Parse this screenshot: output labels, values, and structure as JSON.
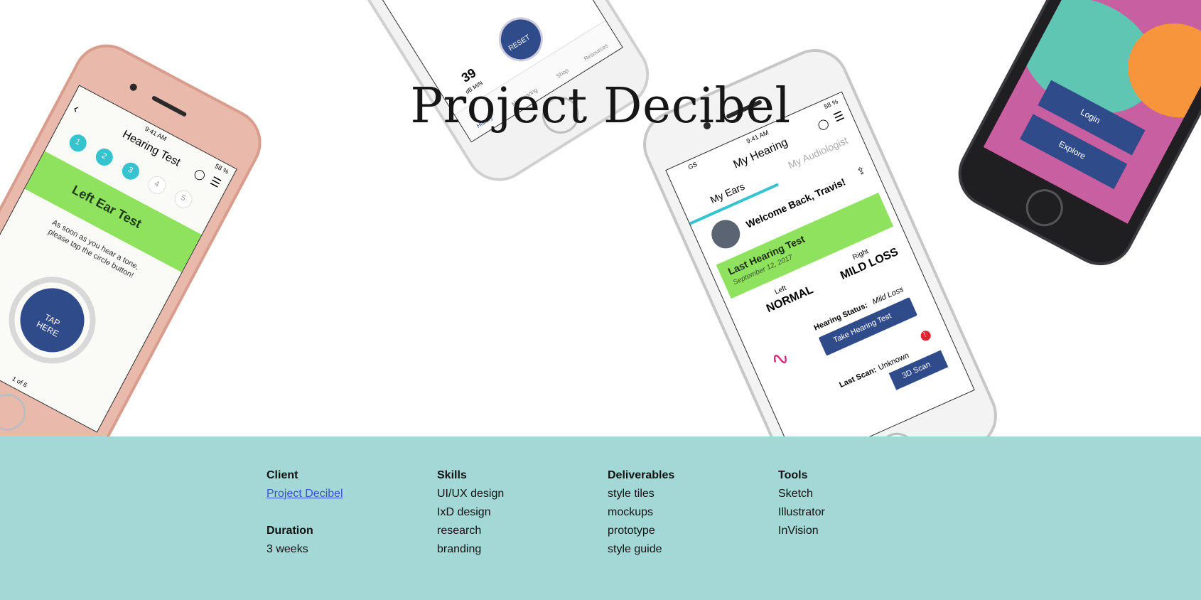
{
  "page": {
    "title": "Project Decibel"
  },
  "phone_left": {
    "status": "9:41 AM",
    "battery": "58 %",
    "screen_title": "Hearing Test",
    "steps": [
      "1",
      "2",
      "3",
      "4",
      "5"
    ],
    "banner": "Left Ear Test",
    "instruction": "As soon as you hear a tone, please tap the circle button!",
    "tap_button": "TAP HERE",
    "pager": "1 of 6"
  },
  "phone_top": {
    "db_value": "39",
    "db_unit": "dB MIN",
    "reset_label": "RESET",
    "nav": [
      "History",
      "My Hearing",
      "Shop",
      "Resources"
    ]
  },
  "phone_center": {
    "status": "9:41 AM",
    "carrier": "GS",
    "battery": "58 %",
    "screen_title": "My Hearing",
    "tabs": [
      "My Ears",
      "My Audiologist"
    ],
    "welcome": "Welcome Back, Travis!",
    "last_test_label": "Last Hearing Test",
    "last_test_date": "September 12, 2017",
    "left_label": "Left",
    "left_value": "NORMAL",
    "right_label": "Right",
    "right_value": "MILD LOSS",
    "status_label": "Hearing Status:",
    "status_value": "Mild Loss",
    "take_test_button": "Take Hearing Test",
    "scan_label": "Last Scan:",
    "scan_value": "Unknown",
    "scan_button": "3D Scan",
    "scan_badge": "!"
  },
  "phone_right": {
    "login_button": "Login",
    "explore_button": "Explore"
  },
  "info": {
    "client": {
      "heading": "Client",
      "value": "Project Decibel"
    },
    "duration": {
      "heading": "Duration",
      "value": "3 weeks"
    },
    "skills": {
      "heading": "Skills",
      "items": [
        "UI/UX design",
        "IxD design",
        "research",
        "branding"
      ]
    },
    "deliverables": {
      "heading": "Deliverables",
      "items": [
        "style tiles",
        "mockups",
        "prototype",
        "style guide"
      ]
    },
    "tools": {
      "heading": "Tools",
      "items": [
        "Sketch",
        "Illustrator",
        "InVision"
      ]
    }
  },
  "colors": {
    "info_bg": "#a3d8d7",
    "accent_green": "#8ee25e",
    "accent_teal": "#35c3cf",
    "navy": "#2f4b8a",
    "link": "#3b4fd6"
  }
}
